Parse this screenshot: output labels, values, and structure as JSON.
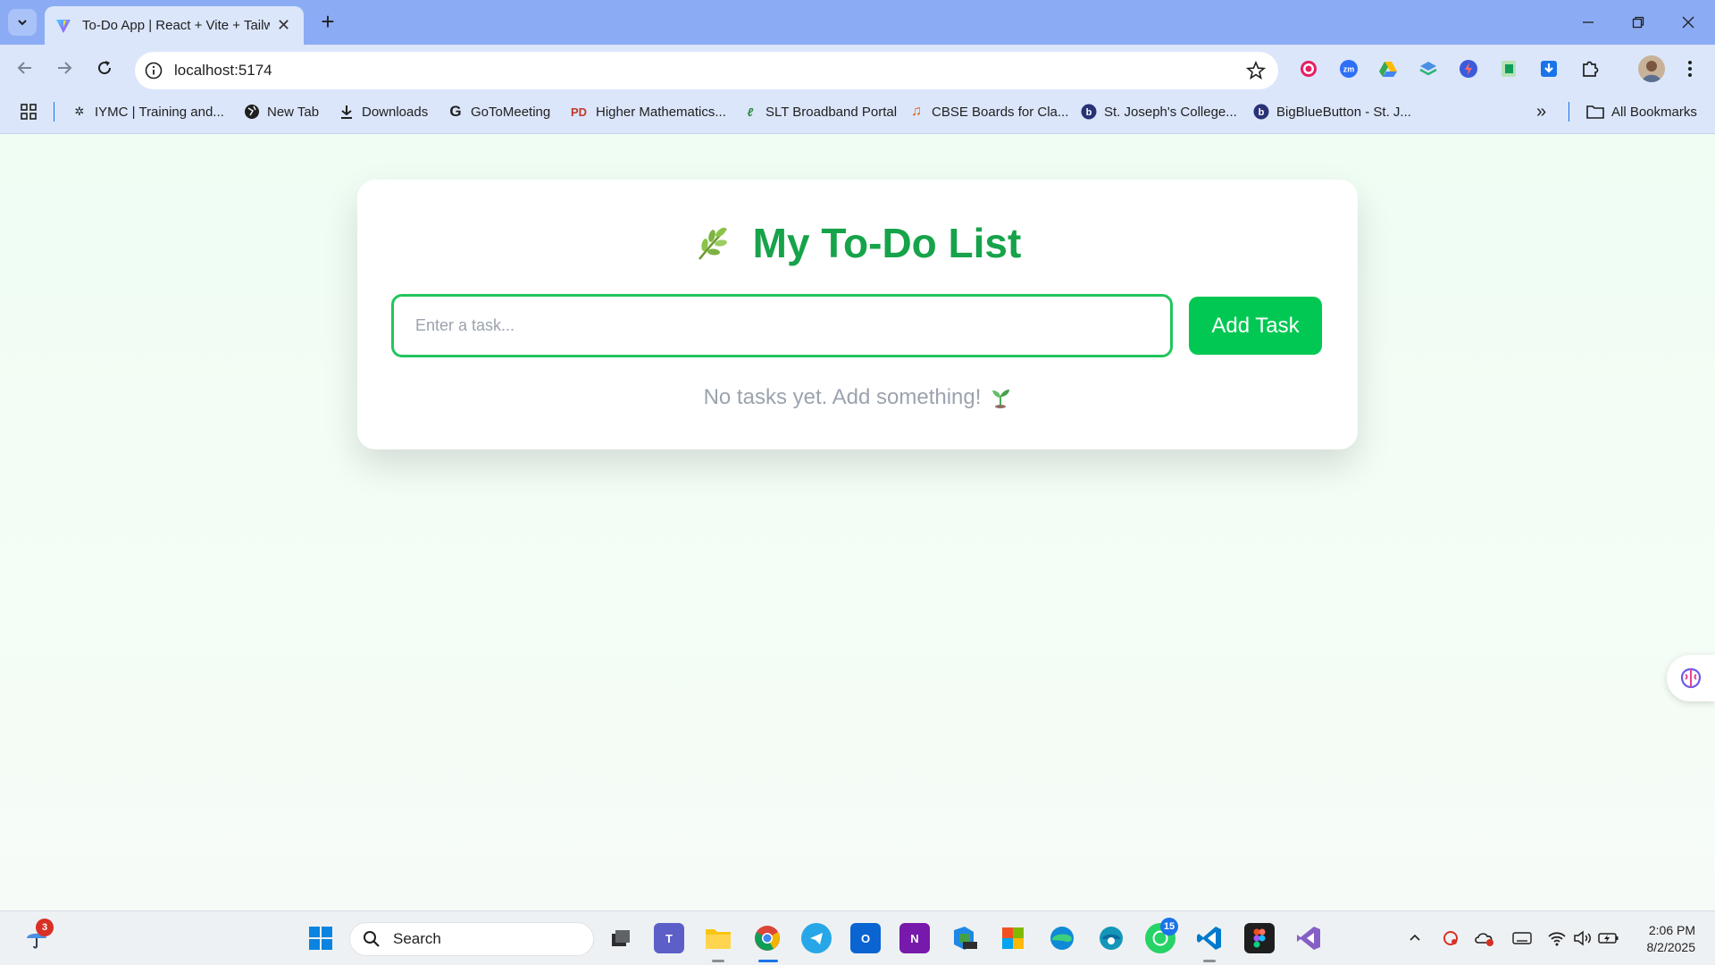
{
  "browser": {
    "tab": {
      "title": "To-Do App | React + Vite + Tailw",
      "favicon": "vite-icon"
    },
    "new_tab_symbol": "+",
    "address": {
      "url": "localhost:5174"
    },
    "bookmarks": [
      {
        "label": "IYMC | Training and...",
        "icon": "iymc-icon"
      },
      {
        "label": "New Tab",
        "icon": "globe-icon"
      },
      {
        "label": "Downloads",
        "icon": "download-icon"
      },
      {
        "label": "GoToMeeting",
        "icon": "gotomeeting-icon"
      },
      {
        "label": "Higher Mathematics...",
        "icon": "pd-icon"
      },
      {
        "label": "SLT Broadband Portal",
        "icon": "slt-icon"
      },
      {
        "label": "CBSE Boards for Cla...",
        "icon": "music-note-icon"
      },
      {
        "label": "St. Joseph's College...",
        "icon": "bigbluebutton-icon"
      },
      {
        "label": "BigBlueButton - St. J...",
        "icon": "bigbluebutton-icon"
      }
    ],
    "all_bookmarks_label": "All Bookmarks",
    "overflow_symbol": "»"
  },
  "app": {
    "title": "My To-Do List",
    "input_placeholder": "Enter a task...",
    "add_button_label": "Add Task",
    "empty_message": "No tasks yet. Add something!",
    "accent_color": "#16a34a",
    "button_color": "#00c853"
  },
  "taskbar": {
    "search_label": "Search",
    "weather_badge": "3",
    "whatsapp_badge": "15",
    "time": "2:06 PM",
    "date": "8/2/2025"
  }
}
